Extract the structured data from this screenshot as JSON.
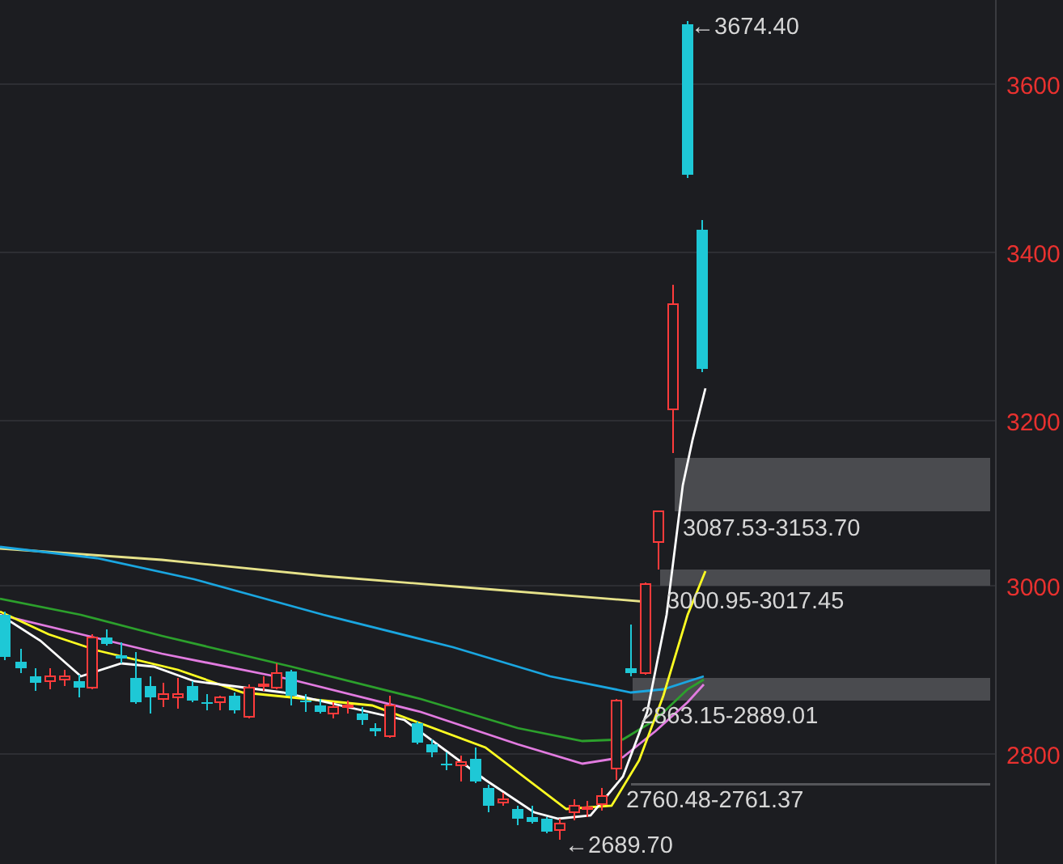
{
  "chart": {
    "y_axis_labels": [
      "3600",
      "3400",
      "3200",
      "3000",
      "2800"
    ],
    "high_label": "←3674.40",
    "low_label": "←2689.70",
    "zones": [
      {
        "label": "3087.53-3153.70"
      },
      {
        "label": "3000.95-3017.45"
      },
      {
        "label": "2863.15-2889.01"
      },
      {
        "label": "2760.48-2761.37"
      }
    ]
  }
}
